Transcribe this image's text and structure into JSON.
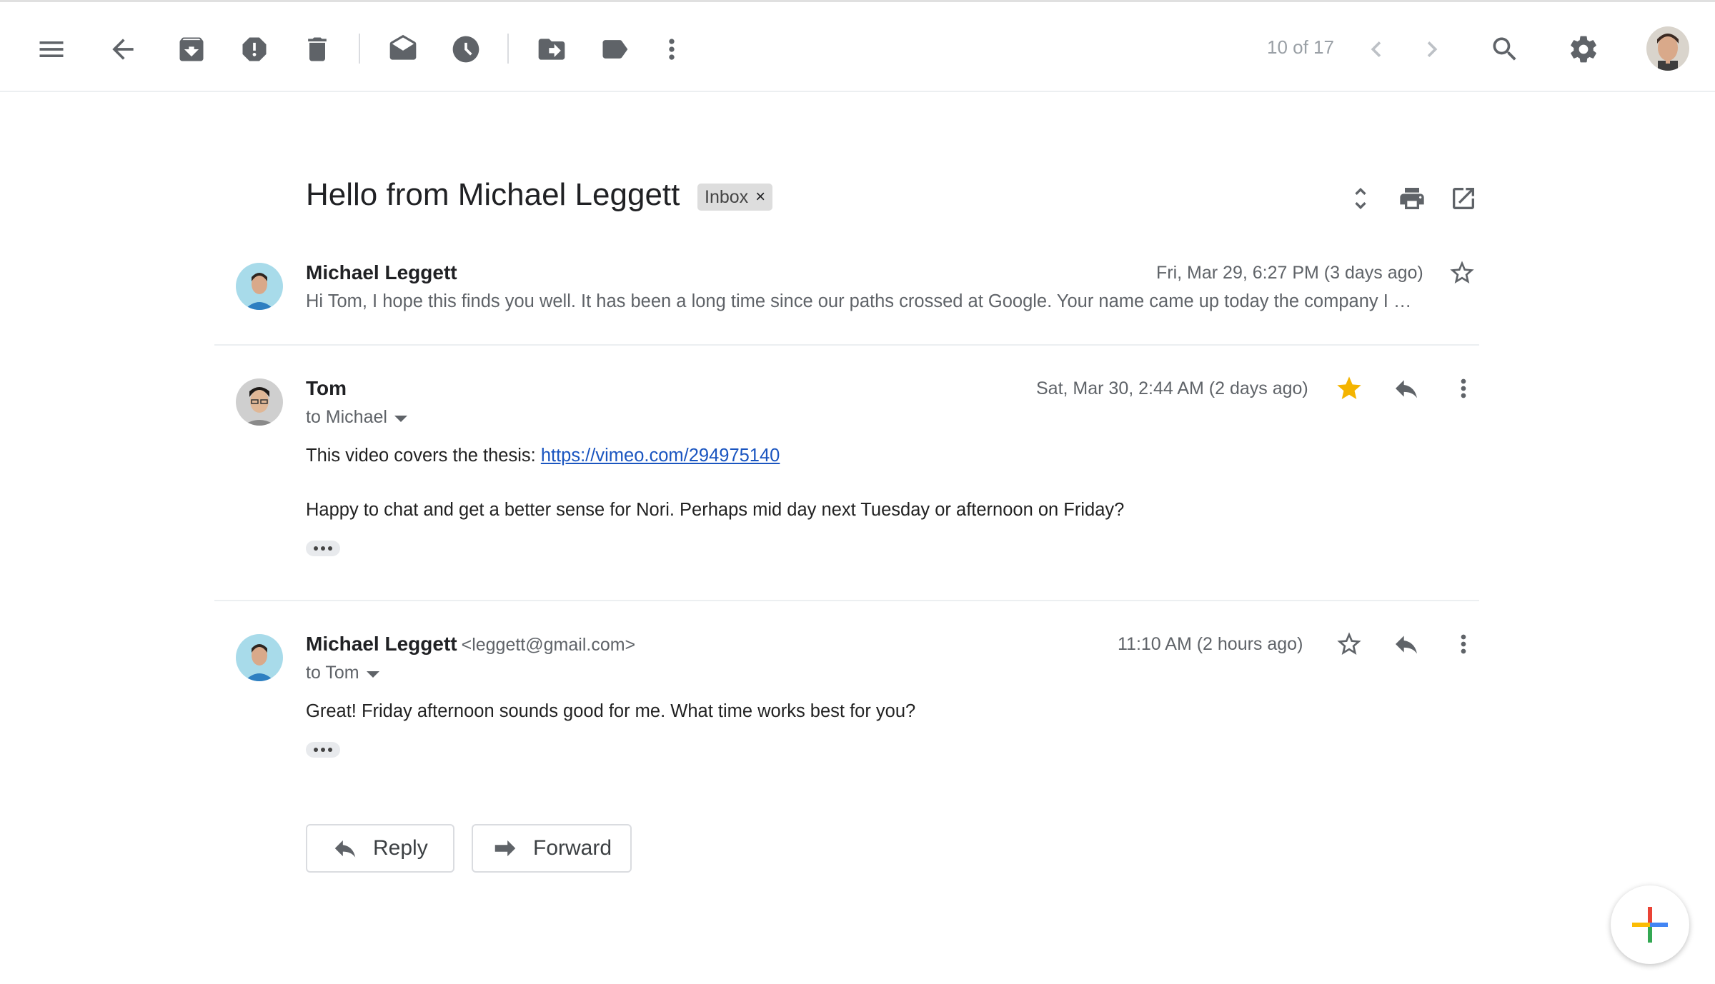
{
  "toolbar": {
    "counter": "10 of 17",
    "icons": [
      "menu-icon",
      "back-icon",
      "archive-icon",
      "report-spam-icon",
      "delete-icon",
      "mark-unread-icon",
      "snooze-icon",
      "move-to-icon",
      "label-icon",
      "more-icon",
      "prev-icon",
      "next-icon",
      "search-icon",
      "settings-icon"
    ]
  },
  "thread": {
    "subject": "Hello from Michael Leggett",
    "label": "Inbox",
    "label_remove": "×"
  },
  "messages": [
    {
      "sender": "Michael Leggett",
      "date": "Fri, Mar 29, 6:27 PM (3 days ago)",
      "snippet": "Hi Tom, I hope this finds you well. It has been a long time since our paths crossed at Google. Your name came up today the company I …",
      "starred": false
    },
    {
      "sender": "Tom",
      "to": "to Michael",
      "date": "Sat, Mar 30, 2:44 AM (2 days ago)",
      "body_prefix": "This video covers the thesis: ",
      "link": "https://vimeo.com/294975140",
      "body_line2": "Happy to chat and get a better sense for Nori.  Perhaps mid day next Tuesday or afternoon on Friday?",
      "starred": true
    },
    {
      "sender": "Michael Leggett",
      "email": "<leggett@gmail.com>",
      "to": "to Tom",
      "date": "11:10 AM (2 hours ago)",
      "body": "Great! Friday afternoon sounds good for me. What time works best for you?",
      "starred": false
    }
  ],
  "actions": {
    "reply": "Reply",
    "forward": "Forward"
  },
  "colors": {
    "star_active": "#f4b400",
    "link": "#1a55c0",
    "icon": "#5f6368"
  }
}
